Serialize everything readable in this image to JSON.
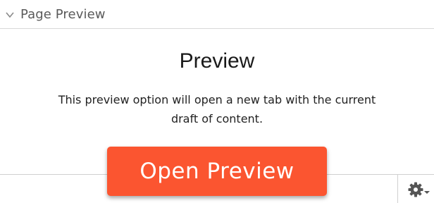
{
  "panel": {
    "title": "Page Preview",
    "toggle_icon": "chevron-down-icon"
  },
  "preview": {
    "heading": "Preview",
    "description_line1": "This preview option will open a new tab with the current",
    "description_line2": "draft of content.",
    "button_label": "Open Preview"
  },
  "footer": {
    "settings_icon": "gear-icon",
    "settings_menu_icon": "caret-down-icon"
  },
  "colors": {
    "button_background": "#fb5530",
    "button_text": "#ffffff"
  }
}
